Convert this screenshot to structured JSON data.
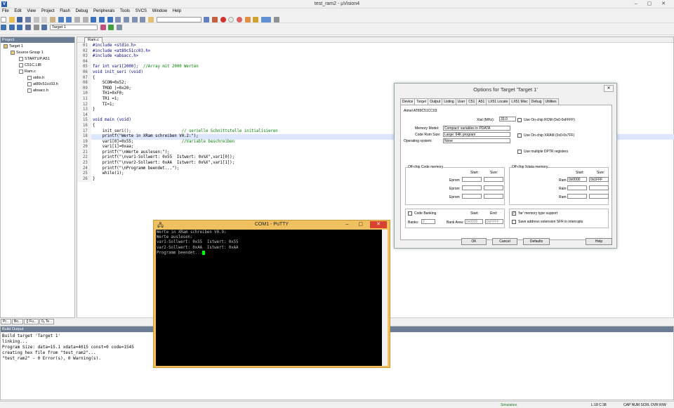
{
  "window": {
    "title": "test_ram2 - µVision4",
    "controls": "–  ▢  ✕"
  },
  "menu": [
    "File",
    "Edit",
    "View",
    "Project",
    "Flash",
    "Debug",
    "Peripherals",
    "Tools",
    "SVCS",
    "Window",
    "Help"
  ],
  "toolbar": {
    "target_select": "Target 1"
  },
  "project": {
    "header": "Project",
    "target": "Target 1",
    "group": "Source Group 1",
    "files": [
      "STARTUP.A51",
      "C51C.LIB",
      "Ram.c"
    ],
    "includes": [
      "stdio.h",
      "at89c51cc03.h",
      "absacc.h"
    ],
    "tabs": [
      "Pr...",
      "Bo...",
      "{} Fu...",
      "0ₐ Te..."
    ]
  },
  "editor": {
    "tab": "Ram.c",
    "lines": [
      {
        "n": "01",
        "t": "#include <stdio.h>",
        "c": ""
      },
      {
        "n": "02",
        "t": "#include <at89c51cc03.h>",
        "c": ""
      },
      {
        "n": "03",
        "t": "#include <absacc.h>",
        "c": ""
      },
      {
        "n": "04",
        "t": "",
        "c": ""
      },
      {
        "n": "05",
        "t": "far int var1[2000];  ",
        "c": "//Array mit 2000 Werten"
      },
      {
        "n": "06",
        "t": "void init_seri (void)",
        "c": ""
      },
      {
        "n": "07",
        "t": "{",
        "c": ""
      },
      {
        "n": "08",
        "t": "    SCON=0x52;",
        "c": ""
      },
      {
        "n": "09",
        "t": "    TMOD |=0x20;",
        "c": ""
      },
      {
        "n": "10",
        "t": "    TH1=0xF0;",
        "c": ""
      },
      {
        "n": "11",
        "t": "    TR1 =1;",
        "c": ""
      },
      {
        "n": "12",
        "t": "    TI=1;",
        "c": ""
      },
      {
        "n": "13",
        "t": "}",
        "c": ""
      },
      {
        "n": "14",
        "t": "",
        "c": ""
      },
      {
        "n": "15",
        "t": "void main (void)",
        "c": ""
      },
      {
        "n": "16",
        "t": "{",
        "c": ""
      },
      {
        "n": "17",
        "t": "    init_seri();                     ",
        "c": "// serielle Schnittstelle initialisieren"
      },
      {
        "n": "18",
        "t": "    printf(\"Werte in XRam schreiben V0.2:\");",
        "c": ""
      },
      {
        "n": "19",
        "t": "    var1[0]=0x55;                    ",
        "c": "//Variable beschreiben"
      },
      {
        "n": "20",
        "t": "    var1[1]=0xaa;",
        "c": ""
      },
      {
        "n": "21",
        "t": "    printf(\"\\nWerte auslesen:\");",
        "c": ""
      },
      {
        "n": "22",
        "t": "    printf(\"\\nvar1-Sollwert: 0x55  Istwert: 0x%X\",var1[0]);",
        "c": ""
      },
      {
        "n": "23",
        "t": "    printf(\"\\nvar2-Sollwert: 0xAA  Istwert: 0x%X\",var1[1]);",
        "c": ""
      },
      {
        "n": "24",
        "t": "    printf(\"\\nProgramm beendet...\");",
        "c": ""
      },
      {
        "n": "25",
        "t": "    while(1);",
        "c": ""
      },
      {
        "n": "26",
        "t": "}",
        "c": ""
      }
    ]
  },
  "build": {
    "header": "Build Output",
    "lines": [
      "Build target 'Target 1'",
      "linking...",
      "Program Size: data=15.1 xdata=4015 const=0 code=1545",
      "creating hex file from \"test_ram2\"...",
      "\"test_ram2\" - 0 Error(s), 0 Warning(s)."
    ]
  },
  "status": {
    "mode": "Simulation",
    "pos": "L:18 C:38",
    "flags": "CAP  NUM  SCRL  OVR  R/W"
  },
  "dialog": {
    "title": "Options for Target 'Target 1'",
    "tabs": [
      "Device",
      "Target",
      "Output",
      "Listing",
      "User",
      "C51",
      "A51",
      "LX51 Locate",
      "LX51 Misc",
      "Debug",
      "Utilities"
    ],
    "device": "Atmel AT89C51CC03",
    "xtal_label": "Xtal (MHz):",
    "xtal": "33.0",
    "memory_model_label": "Memory Model:",
    "memory_model": "Compact: variables in PDATA",
    "code_rom_label": "Code Rom Size:",
    "code_rom": "Large: 64K program",
    "os_label": "Operating system:",
    "os": "None",
    "onchip_rom": "Use On-chip ROM (0x0-0xFFFF)",
    "onchip_xram": "Use On-chip XRAM (0x0-0x7FF)",
    "dptr": "Use multiple DPTR registers",
    "code_mem_title": "Off-chip Code memory",
    "start": "Start:",
    "size": "Size:",
    "eprom": "Eprom",
    "xdata_title": "Off-chip Xdata memory",
    "ram": "Ram",
    "ram_start": "0x0000",
    "ram_size": "0x1FFF",
    "code_banking": "Code Banking",
    "banks_label": "Banks:",
    "banks": "2",
    "bank_area": "Bank Area:",
    "bank_start": "0x0000",
    "bank_end": "0xFFFF",
    "end": "End:",
    "far_mem": "'far' memory type support",
    "save_ext": "Save address extension SFR in interrupts",
    "ok": "OK",
    "cancel": "Cancel",
    "defaults": "Defaults",
    "help": "Help"
  },
  "putty": {
    "title": "COM1 - PuTTY",
    "lines": [
      "Werte in XRam schreiben V0.9:",
      "Werte auslesen:",
      "var1-Sollwert: 0x55  Istwert: 0x55",
      "var2-Sollwert: 0xAA  Istwert: 0xAA",
      "Programm beendet..."
    ]
  }
}
